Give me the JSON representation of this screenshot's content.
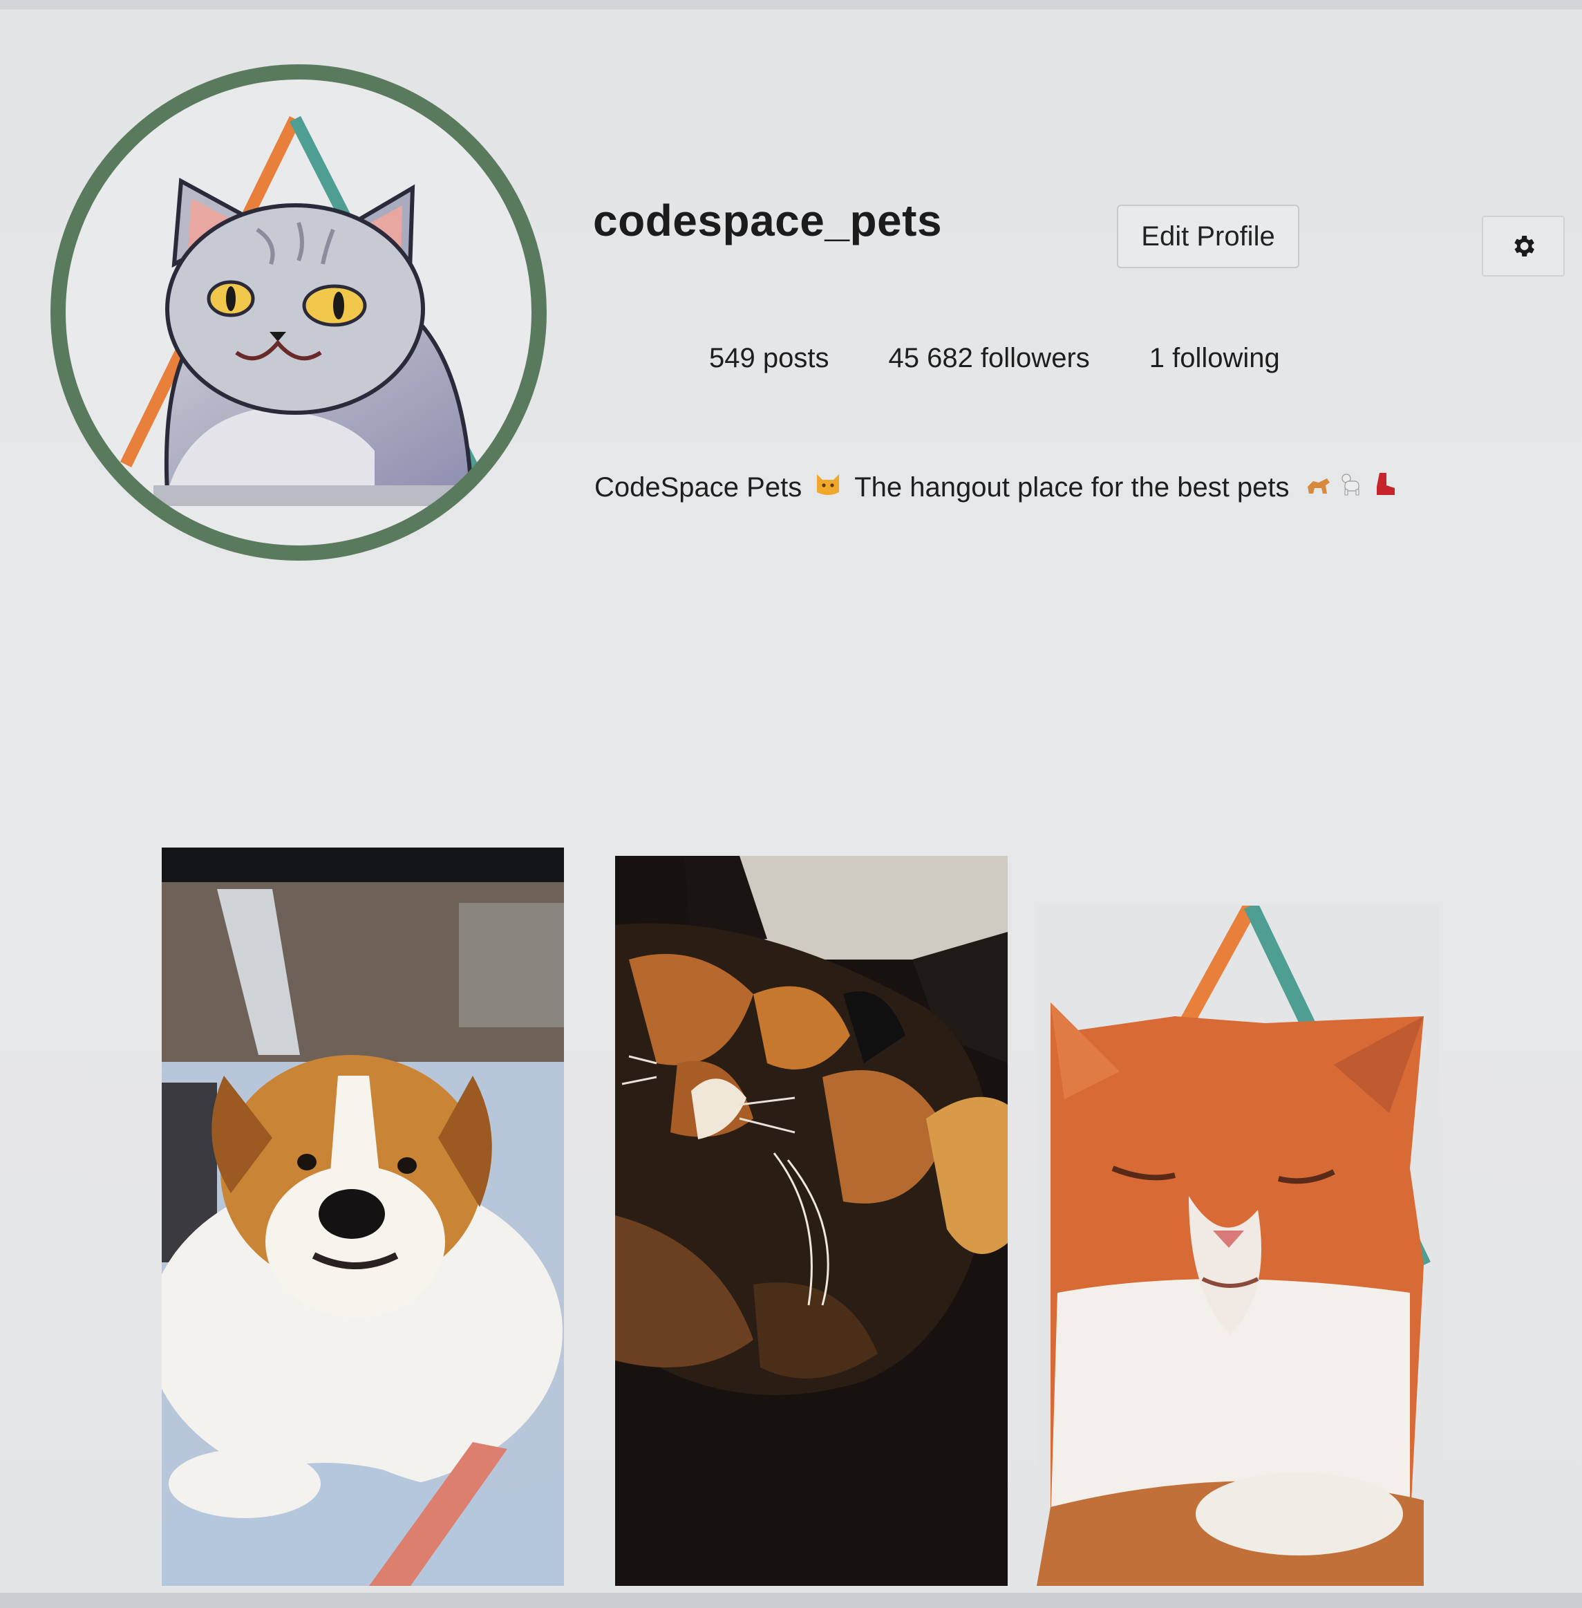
{
  "profile": {
    "username": "codespace_pets",
    "edit_label": "Edit Profile",
    "settings_icon": "gear-icon",
    "stats": {
      "posts": "549 posts",
      "followers": "45 682 followers",
      "following": "1 following"
    },
    "bio": {
      "name": "CodeSpace Pets",
      "text": "The hangout place for the best pets",
      "name_emoji": "cat-face-emoji",
      "trailing_emojis": [
        "dog-emoji",
        "poodle-emoji",
        "boot-emoji"
      ]
    }
  },
  "posts": [
    {
      "subject": "dog-photo"
    },
    {
      "subject": "calico-cat-photo"
    },
    {
      "subject": "orange-cat-photo"
    }
  ],
  "colors": {
    "avatar_ring": "#5a7a5e",
    "triangle_orange": "#e8803c",
    "triangle_teal": "#4e9e93",
    "background": "#e5e6e8"
  }
}
